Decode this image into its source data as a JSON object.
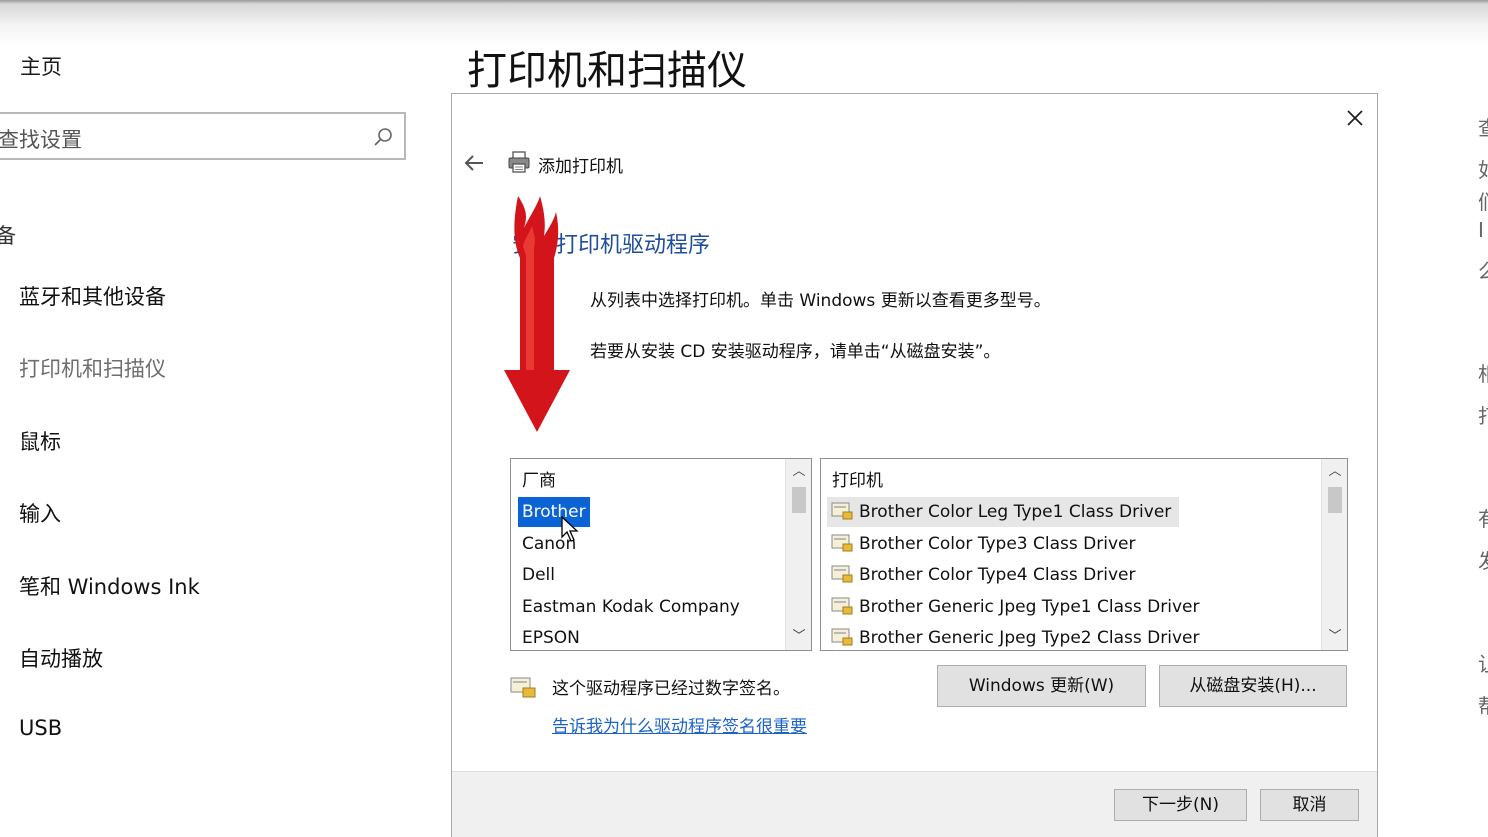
{
  "settings": {
    "home_label": "主页",
    "search_placeholder": "查找设置",
    "nav_group_label": "设备",
    "nav_items": [
      {
        "label": "蓝牙和其他设备"
      },
      {
        "label": "打印机和扫描仪"
      },
      {
        "label": "鼠标"
      },
      {
        "label": "输入"
      },
      {
        "label": "笔和 Windows Ink"
      },
      {
        "label": "自动播放"
      },
      {
        "label": "USB"
      }
    ],
    "page_title": "打印机和扫描仪",
    "right_edge_glyphs": [
      "查",
      "如",
      "们",
      "I",
      "么",
      "相",
      "打",
      "有",
      "发",
      "让",
      "帮"
    ]
  },
  "dialog": {
    "title": "添加打印机",
    "heading": "安装打印机驱动程序",
    "desc1": "从列表中选择打印机。单击 Windows 更新以查看更多型号。",
    "desc2": "若要从安装 CD 安装驱动程序，请单击“从磁盘安装”。",
    "manufacturer_header": "厂商",
    "manufacturers": [
      "Brother",
      "Canon",
      "Dell",
      "Eastman Kodak Company",
      "EPSON"
    ],
    "selected_manufacturer": "Brother",
    "printer_header": "打印机",
    "printers": [
      "Brother Color Leg Type1 Class Driver",
      "Brother Color Type3 Class Driver",
      "Brother Color Type4 Class Driver",
      "Brother Generic Jpeg Type1 Class Driver",
      "Brother Generic Jpeg Type2 Class Driver"
    ],
    "signed_text": "这个驱动程序已经过数字签名。",
    "signed_link": "告诉我为什么驱动程序签名很重要",
    "windows_update_button": "Windows 更新(W)",
    "have_disk_button": "从磁盘安装(H)...",
    "next_button": "下一步(N)",
    "cancel_button": "取消"
  },
  "colors": {
    "accent": "#0a64d6",
    "heading": "#1f4e9b",
    "link": "#1b63c6",
    "annotation_arrow": "#d4141b"
  },
  "icons": [
    "search-icon",
    "close-icon",
    "back-arrow-icon",
    "printer-icon",
    "driver-icon",
    "signed-driver-icon",
    "chevron-up-icon",
    "chevron-down-icon",
    "mouse-cursor-icon",
    "annotation-arrow"
  ]
}
